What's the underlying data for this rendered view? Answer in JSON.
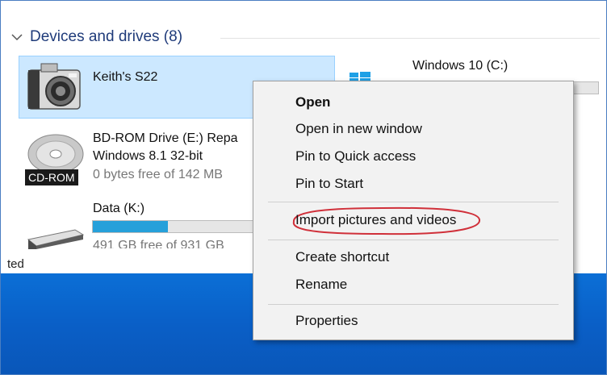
{
  "section": {
    "title": "Devices and drives (8)"
  },
  "devices": [
    {
      "name": "Keith's S22"
    },
    {
      "name": "Windows 10 (C:)"
    },
    {
      "name": "BD-ROM Drive (E:) Repa",
      "subtitle": "Windows 8.1 32-bit",
      "free": "0 bytes free of 142 MB",
      "badge": "CD-ROM"
    },
    {
      "name": "Data (K:)",
      "free": "491 GB free of 931 GB",
      "used_fraction": 0.47
    }
  ],
  "status_text": "ted",
  "context_menu": {
    "items": [
      {
        "label": "Open",
        "bold": true
      },
      {
        "label": "Open in new window"
      },
      {
        "label": "Pin to Quick access"
      },
      {
        "label": "Pin to Start"
      },
      {
        "label": "Import pictures and videos",
        "circled": true
      },
      {
        "label": "Create shortcut"
      },
      {
        "label": "Rename"
      },
      {
        "label": "Properties"
      }
    ]
  },
  "colors": {
    "selection": "#cce8ff",
    "drive_fill": "#26a0da",
    "annotation": "#d0303a",
    "desktop": "#0a5fc7"
  }
}
